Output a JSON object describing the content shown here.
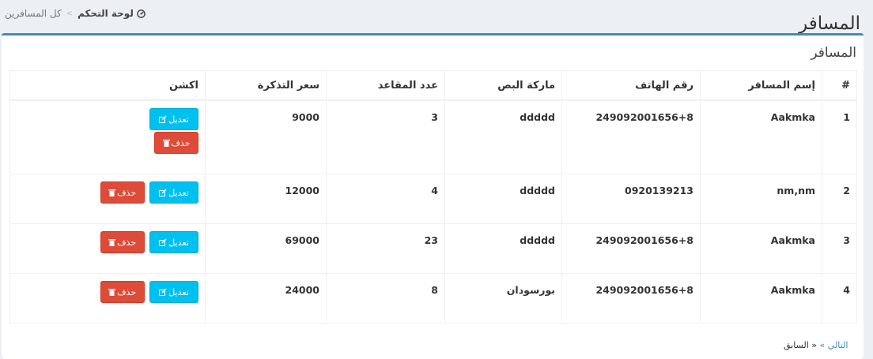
{
  "header": {
    "title": "المسافر",
    "breadcrumb": {
      "home": "لوحة التحكم",
      "current": "كل المسافرين"
    }
  },
  "box": {
    "title": "المسافر"
  },
  "table": {
    "columns": [
      "#",
      "إسم المسافر",
      "رقم الهاتف",
      "ماركة البص",
      "عدد المقاعد",
      "سعر التذكرة",
      "اكشن"
    ],
    "rows": [
      {
        "num": "1",
        "name": "Aakmka",
        "phone": "249092001656+8",
        "bus": "ddddd",
        "seats": "3",
        "price": "9000"
      },
      {
        "num": "2",
        "name": "nm,nm",
        "phone": "0920139213",
        "bus": "ddddd",
        "seats": "4",
        "price": "12000"
      },
      {
        "num": "3",
        "name": "Aakmka",
        "phone": "249092001656+8",
        "bus": "ddddd",
        "seats": "23",
        "price": "69000"
      },
      {
        "num": "4",
        "name": "Aakmka",
        "phone": "249092001656+8",
        "bus": "بورسودان",
        "seats": "8",
        "price": "24000"
      }
    ],
    "edit_label": "تعديل",
    "delete_label": "حذف"
  },
  "pagination": {
    "prev": "« السابق",
    "next": "التالي »"
  },
  "colors": {
    "accent": "#3c8dbc",
    "edit": "#00c0ef",
    "delete": "#dd4b39"
  }
}
